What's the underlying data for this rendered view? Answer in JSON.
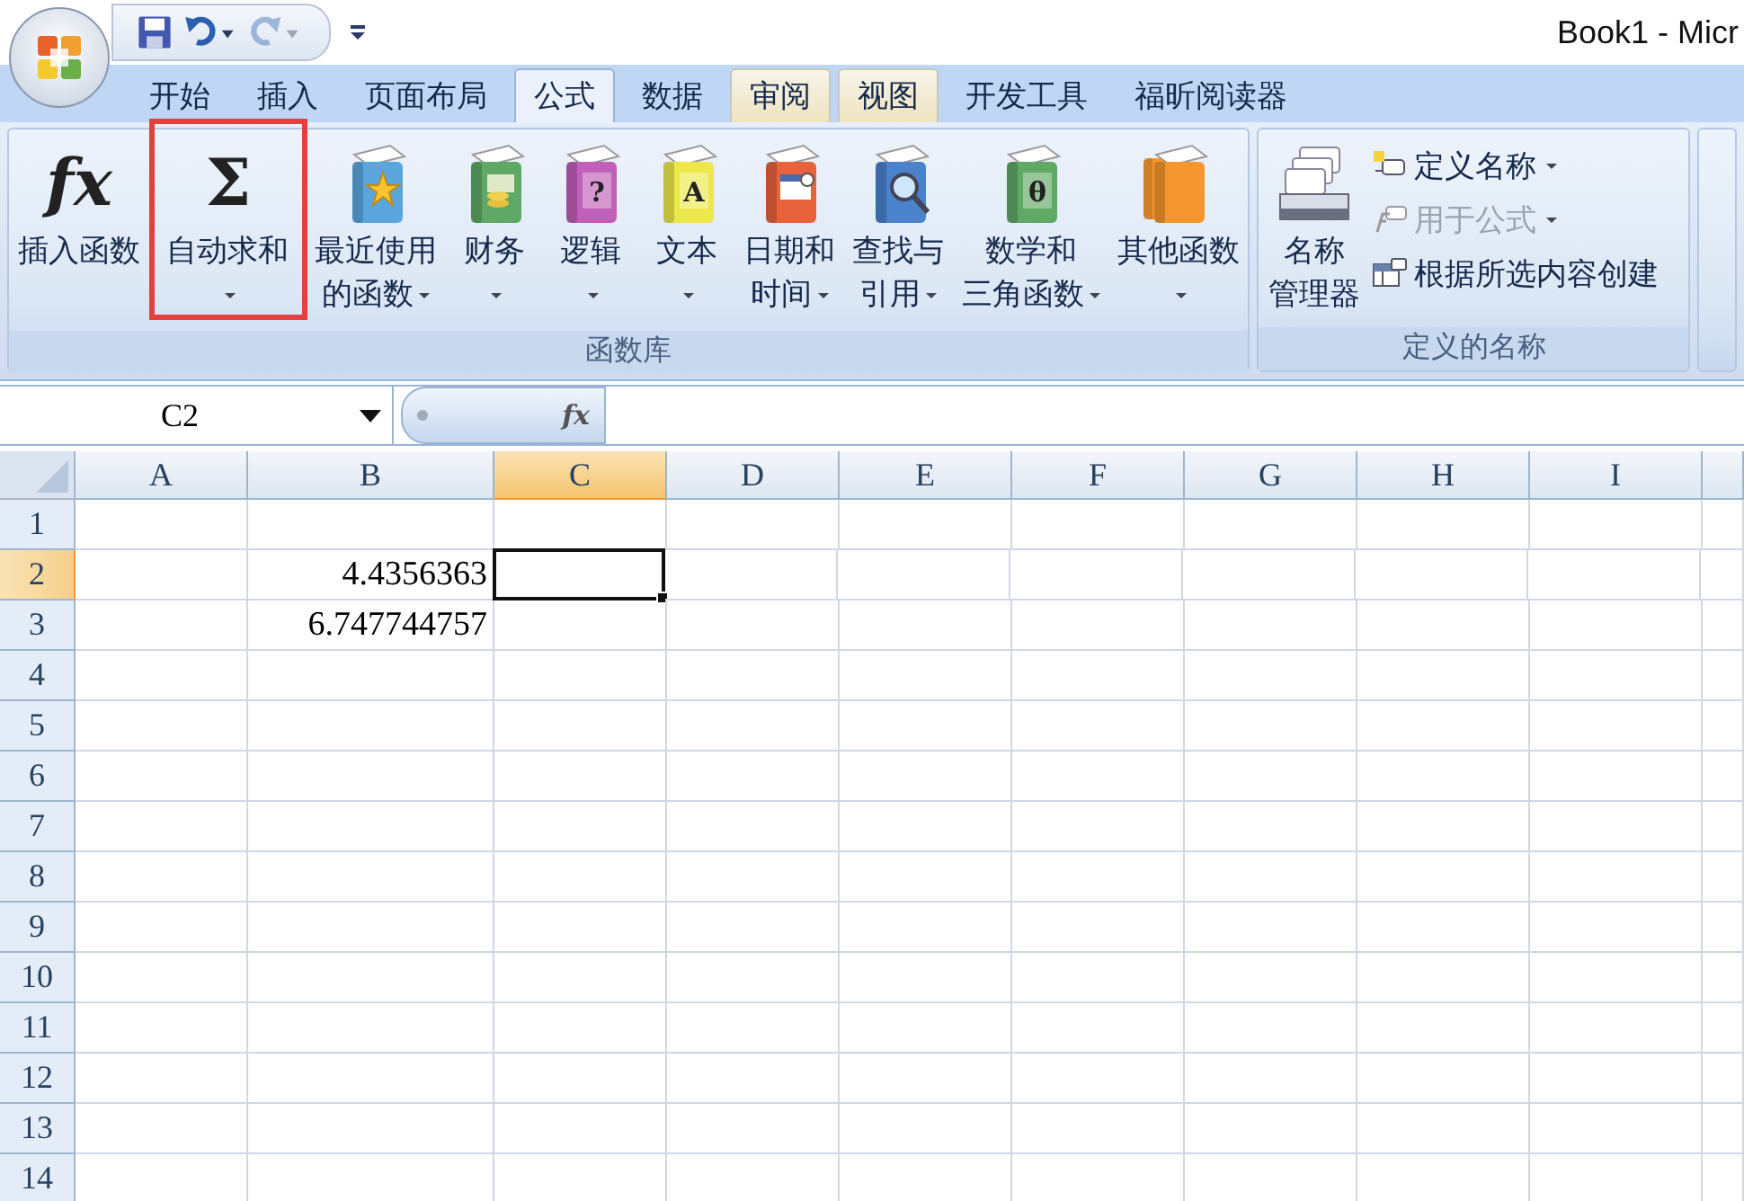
{
  "window": {
    "title": "Book1 - Micr"
  },
  "quick_access": [
    {
      "kind": "save",
      "disabled": false
    },
    {
      "kind": "undo",
      "disabled": false
    },
    {
      "kind": "redo",
      "disabled": true
    }
  ],
  "tabs": [
    {
      "label": "开始",
      "selected": false,
      "highlighted": false
    },
    {
      "label": "插入",
      "selected": false,
      "highlighted": false
    },
    {
      "label": "页面布局",
      "selected": false,
      "highlighted": false
    },
    {
      "label": "公式",
      "selected": true,
      "highlighted": false
    },
    {
      "label": "数据",
      "selected": false,
      "highlighted": false
    },
    {
      "label": "审阅",
      "selected": false,
      "highlighted": true
    },
    {
      "label": "视图",
      "selected": false,
      "highlighted": true
    },
    {
      "label": "开发工具",
      "selected": false,
      "highlighted": false
    },
    {
      "label": "福昕阅读器",
      "selected": false,
      "highlighted": false
    }
  ],
  "ribbon": {
    "groups": [
      {
        "kind": "large",
        "label": "函数库",
        "buttons": [
          {
            "kind": "letter",
            "glyph": "fx",
            "lines": [
              "插入函数"
            ],
            "dropdown": false,
            "marked": false
          },
          {
            "kind": "letter",
            "glyph": "Σ",
            "lines": [
              "自动求和"
            ],
            "dropdown": true,
            "marked": true
          },
          {
            "kind": "star",
            "color": "#5aa6dc",
            "lines": [
              "最近使用",
              "的函数"
            ],
            "dropdown": true,
            "marked": false
          },
          {
            "kind": "coins",
            "color": "#5fa865",
            "lines": [
              "财务"
            ],
            "dropdown": true,
            "marked": false
          },
          {
            "kind": "glyph",
            "glyph": "?",
            "color": "#c060b8",
            "lines": [
              "逻辑"
            ],
            "dropdown": true,
            "marked": false
          },
          {
            "kind": "glyph",
            "glyph": "A",
            "color": "#ece84a",
            "lines": [
              "文本"
            ],
            "dropdown": true,
            "marked": false
          },
          {
            "kind": "calendar",
            "color": "#e8623c",
            "lines": [
              "日期和",
              "时间"
            ],
            "dropdown": true,
            "marked": false
          },
          {
            "kind": "search",
            "color": "#4a82cc",
            "lines": [
              "查找与",
              "引用"
            ],
            "dropdown": true,
            "marked": false
          },
          {
            "kind": "glyph",
            "glyph": "θ",
            "color": "#5fa865",
            "lines": [
              "数学和",
              "三角函数"
            ],
            "dropdown": true,
            "marked": false
          },
          {
            "kind": "pair",
            "color": "#f5962e",
            "lines": [
              "其他函数"
            ],
            "dropdown": true,
            "marked": false
          }
        ]
      },
      {
        "kind": "mixed",
        "label": "定义的名称",
        "big_button": {
          "lines": [
            "名称",
            "管理器"
          ]
        },
        "items": [
          {
            "kind": "define",
            "label": "定义名称",
            "dropdown": true,
            "disabled": false
          },
          {
            "kind": "formula",
            "label": "用于公式",
            "dropdown": true,
            "disabled": true
          },
          {
            "kind": "create",
            "label": "根据所选内容创建",
            "dropdown": false,
            "disabled": false
          }
        ]
      }
    ]
  },
  "formula_bar": {
    "name_box": "C2",
    "fx": "fx"
  },
  "sheet": {
    "columns": [
      {
        "label": "A",
        "selected": false
      },
      {
        "label": "B",
        "selected": false
      },
      {
        "label": "C",
        "selected": true
      },
      {
        "label": "D",
        "selected": false
      },
      {
        "label": "E",
        "selected": false
      },
      {
        "label": "F",
        "selected": false
      },
      {
        "label": "G",
        "selected": false
      },
      {
        "label": "H",
        "selected": false
      },
      {
        "label": "I",
        "selected": false
      }
    ],
    "rows": [
      {
        "label": "1",
        "selected": false
      },
      {
        "label": "2",
        "selected": true,
        "cells": [
          null,
          {
            "value": "4.4356363",
            "active": false
          },
          {
            "active": true
          }
        ]
      },
      {
        "label": "3",
        "selected": false,
        "cells": [
          null,
          {
            "value": "6.747744757",
            "active": false
          }
        ]
      },
      {
        "label": "4",
        "selected": false
      },
      {
        "label": "5",
        "selected": false
      },
      {
        "label": "6",
        "selected": false
      },
      {
        "label": "7",
        "selected": false
      },
      {
        "label": "8",
        "selected": false
      },
      {
        "label": "9",
        "selected": false
      },
      {
        "label": "10",
        "selected": false
      },
      {
        "label": "11",
        "selected": false
      },
      {
        "label": "12",
        "selected": false
      },
      {
        "label": "13",
        "selected": false
      },
      {
        "label": "14",
        "selected": false
      }
    ]
  }
}
